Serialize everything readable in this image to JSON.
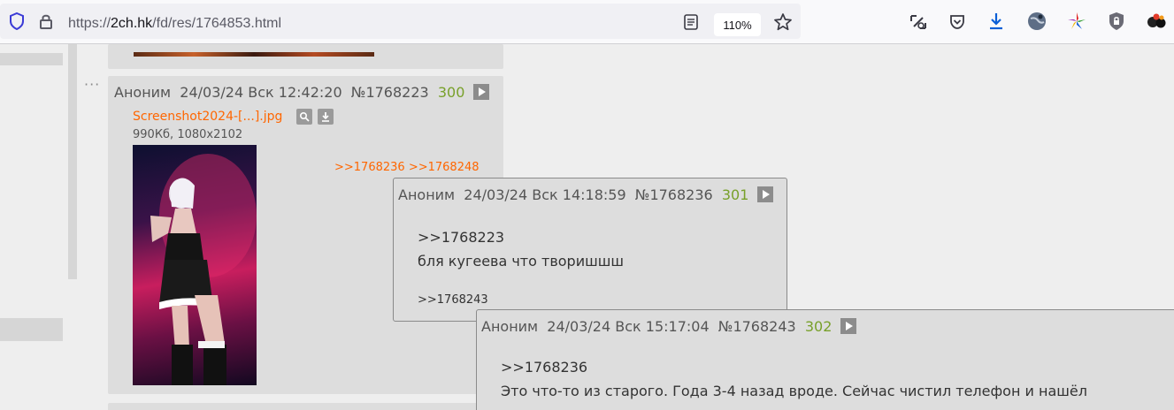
{
  "browser": {
    "url_prefix": "https://",
    "url_host": "2ch.hk",
    "url_path": "/fd/res/1764853.html",
    "zoom": "110%",
    "icons": [
      "shield-icon",
      "lock-icon",
      "reader-view-icon",
      "bookmark-star-icon",
      "extension-icon",
      "pocket-icon",
      "download-icon",
      "globe-avatar-icon",
      "colorful-star-extension-icon",
      "privacy-badge-icon",
      "extension-balls-icon"
    ]
  },
  "post_main": {
    "name": "Аноним",
    "date": "24/03/24 Вск 12:42:20",
    "number": "№1768223",
    "index": "300",
    "file_name": "Screenshot2024-[...].jpg",
    "file_info": "990Кб, 1080x2102",
    "replies": [
      ">>1768236",
      ">>1768248"
    ],
    "dots": "···"
  },
  "popup_1": {
    "name": "Аноним",
    "date": "24/03/24 Вск 14:18:59",
    "number": "№1768236",
    "index": "301",
    "quote": ">>1768223",
    "text": "бля кугеева что творишшш",
    "reply": ">>1768243"
  },
  "popup_2": {
    "name": "Аноним",
    "date": "24/03/24 Вск 15:17:04",
    "number": "№1768243",
    "index": "302",
    "quote": ">>1768236",
    "text": "Это что-то из старого. Года 3-4 назад вроде. Сейчас чистил телефон и нашёл"
  },
  "colors": {
    "link": "#ff6600",
    "index_green": "#78a02a",
    "post_bg": "#dddddd",
    "page_bg": "#eeeeee"
  }
}
